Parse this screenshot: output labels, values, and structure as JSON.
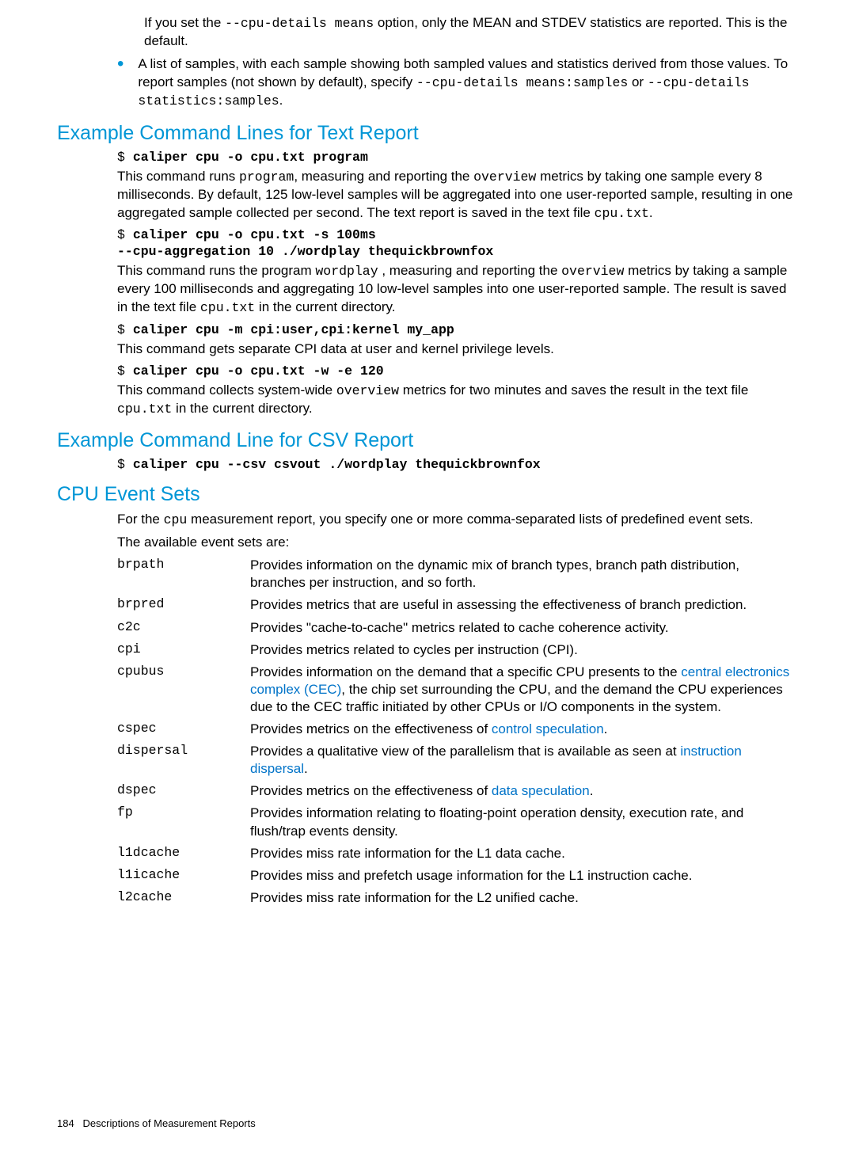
{
  "intro": {
    "p1a": "If you set the ",
    "p1code": "--cpu-details means",
    "p1b": " option, only the MEAN and STDEV statistics are reported. This is the default.",
    "bullet_a": "A list of samples, with each sample showing both sampled values and statistics derived from those values. To report samples (not shown by default), specify ",
    "bullet_code1": "--cpu-details means:samples",
    "bullet_mid": " or ",
    "bullet_code2": "--cpu-details statistics:samples",
    "bullet_b": "."
  },
  "sec1": {
    "title": "Example Command Lines for Text Report",
    "cmd1": "$ caliper cpu -o cpu.txt program",
    "p1a": "This command runs ",
    "p1code1": "program",
    "p1b": ", measuring and reporting the ",
    "p1code2": "overview",
    "p1c": " metrics by taking one sample every 8 milliseconds. By default, 125 low-level samples will be aggregated into one user-reported sample, resulting in one aggregated sample collected per second. The text report is saved in the text file ",
    "p1code3": "cpu.txt",
    "p1d": ".",
    "cmd2a": "$ caliper cpu -o cpu.txt -s 100ms",
    "cmd2b": "--cpu-aggregation 10 ./wordplay thequickbrownfox",
    "p2a": "This command runs the program ",
    "p2code1": "wordplay",
    "p2b": " , measuring and reporting the ",
    "p2code2": "overview",
    "p2c": " metrics by taking a sample every 100 milliseconds and aggregating 10 low-level samples into one user-reported sample. The result is saved in the text file ",
    "p2code3": "cpu.txt",
    "p2d": " in the current directory.",
    "cmd3": "$ caliper cpu -m cpi:user,cpi:kernel my_app",
    "p3": "This command gets separate CPI data at user and kernel privilege levels.",
    "cmd4": "$ caliper cpu -o cpu.txt -w -e 120",
    "p4a": "This command collects system-wide ",
    "p4code1": "overview",
    "p4b": " metrics for two minutes and saves the result in the text file ",
    "p4code2": "cpu.txt",
    "p4c": " in the current directory."
  },
  "sec2": {
    "title": "Example Command Line for CSV Report",
    "cmd1": "$ caliper cpu --csv csvout ./wordplay thequickbrownfox"
  },
  "sec3": {
    "title": "CPU Event Sets",
    "p1a": "For the ",
    "p1code": "cpu",
    "p1b": " measurement report, you specify one or more comma-separated lists of predefined event sets.",
    "p2": "The available event sets are:",
    "defs": {
      "brpath": "Provides information on the dynamic mix of branch types, branch path distribution, branches per instruction, and so forth.",
      "brpred": "Provides metrics that are useful in assessing the effectiveness of branch prediction.",
      "c2c": "Provides \"cache-to-cache\" metrics related to cache coherence activity.",
      "cpi": "Provides metrics related to cycles per instruction (CPI).",
      "cpubus_a": "Provides information on the demand that a specific CPU presents to the ",
      "cpubus_link": "central electronics complex (CEC)",
      "cpubus_b": ", the chip set surrounding the CPU, and the demand the CPU experiences due to the CEC traffic initiated by other CPUs or I/O components in the system.",
      "cspec_a": "Provides metrics on the effectiveness of ",
      "cspec_link": "control speculation",
      "cspec_b": ".",
      "dispersal_a": "Provides a qualitative view of the parallelism that is available as seen at ",
      "dispersal_link": "instruction dispersal",
      "dispersal_b": ".",
      "dspec_a": "Provides metrics on the effectiveness of ",
      "dspec_link": "data speculation",
      "dspec_b": ".",
      "fp": "Provides information relating to floating-point operation density, execution rate, and flush/trap events density.",
      "l1dcache": "Provides miss rate information for the L1 data cache.",
      "l1icache": "Provides miss and prefetch usage information for the L1 instruction cache.",
      "l2cache": "Provides miss rate information for the L2 unified cache.",
      "terms": {
        "brpath": "brpath",
        "brpred": "brpred",
        "c2c": "c2c",
        "cpi": "cpi",
        "cpubus": "cpubus",
        "cspec": "cspec",
        "dispersal": "dispersal",
        "dspec": "dspec",
        "fp": "fp",
        "l1dcache": "l1dcache",
        "l1icache": "l1icache",
        "l2cache": "l2cache"
      }
    }
  },
  "footer": {
    "page": "184",
    "title": "Descriptions of Measurement Reports"
  }
}
